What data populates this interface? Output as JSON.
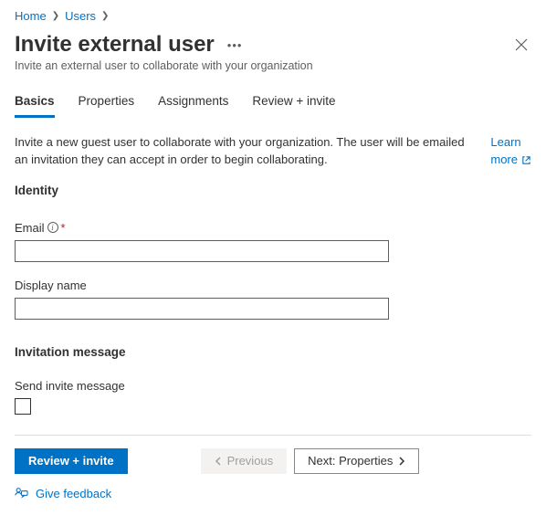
{
  "breadcrumb": {
    "home": "Home",
    "users": "Users"
  },
  "header": {
    "title": "Invite external user",
    "subtitle": "Invite an external user to collaborate with your organization"
  },
  "tabs": {
    "basics": "Basics",
    "properties": "Properties",
    "assignments": "Assignments",
    "review": "Review + invite"
  },
  "intro": {
    "text": "Invite a new guest user to collaborate with your organization. The user will be emailed an invitation they can accept in order to begin collaborating.",
    "learn": "Learn",
    "more": "more"
  },
  "identity": {
    "heading": "Identity",
    "email_label": "Email",
    "email_value": "",
    "display_label": "Display name",
    "display_value": ""
  },
  "invitation": {
    "heading": "Invitation message",
    "send_label": "Send invite message"
  },
  "footer": {
    "review": "Review + invite",
    "previous": "Previous",
    "next": "Next: Properties",
    "feedback": "Give feedback"
  }
}
